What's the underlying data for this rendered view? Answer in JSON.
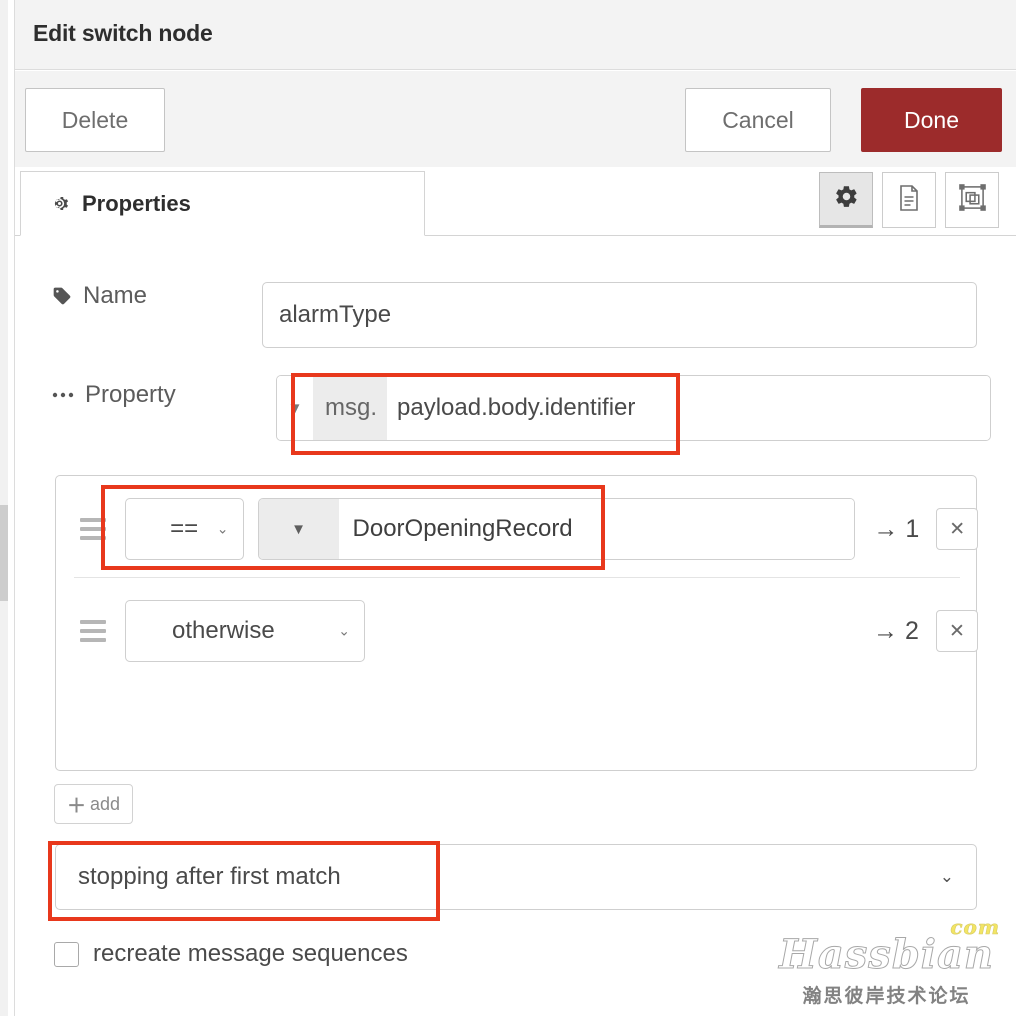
{
  "window": {
    "title": "Edit switch node"
  },
  "toolbar": {
    "delete_label": "Delete",
    "cancel_label": "Cancel",
    "done_label": "Done"
  },
  "tabs": [
    {
      "label": "Properties",
      "icon": "gear-icon",
      "active": true
    }
  ],
  "icon_buttons": [
    {
      "name": "properties-gear-icon",
      "active": true
    },
    {
      "name": "description-document-icon",
      "active": false
    },
    {
      "name": "appearance-shapes-icon",
      "active": false
    }
  ],
  "fields": {
    "name": {
      "label": "Name",
      "icon": "tag-icon",
      "value": "alarmType",
      "placeholder": "Name"
    },
    "property": {
      "label": "Property",
      "icon": "ellipsis-icon",
      "type_prefix": "msg.",
      "value": "payload.body.identifier",
      "caret": "▼"
    }
  },
  "rules": [
    {
      "operator": "==",
      "value_type_caret": "▼",
      "value": "DoorOpeningRecord",
      "output": "→ 1",
      "delete_glyph": "✕",
      "has_value_field": true
    },
    {
      "operator": "otherwise",
      "value_type_caret": "",
      "value": "",
      "output": "→ 2",
      "delete_glyph": "✕",
      "has_value_field": false
    }
  ],
  "add_button": {
    "plus": "＋",
    "label": "add"
  },
  "stop_select": {
    "value": "stopping after first match",
    "caret": "⌄"
  },
  "recreate_checkbox": {
    "label": "recreate message sequences",
    "checked": false
  },
  "annotations": {
    "highlight_color": "#e8381c",
    "boxes": [
      {
        "name": "property-highlight"
      },
      {
        "name": "rule-condition-highlight"
      },
      {
        "name": "stop-mode-highlight"
      }
    ]
  },
  "watermark": {
    "brand": "Hassbian",
    "tld": "com",
    "subtitle": "瀚思彼岸技术论坛"
  },
  "colors": {
    "done_button": "#9c2b2b",
    "header_bg": "#f3f3f3",
    "border": "#cfcfcf",
    "annotation": "#e8381c"
  }
}
